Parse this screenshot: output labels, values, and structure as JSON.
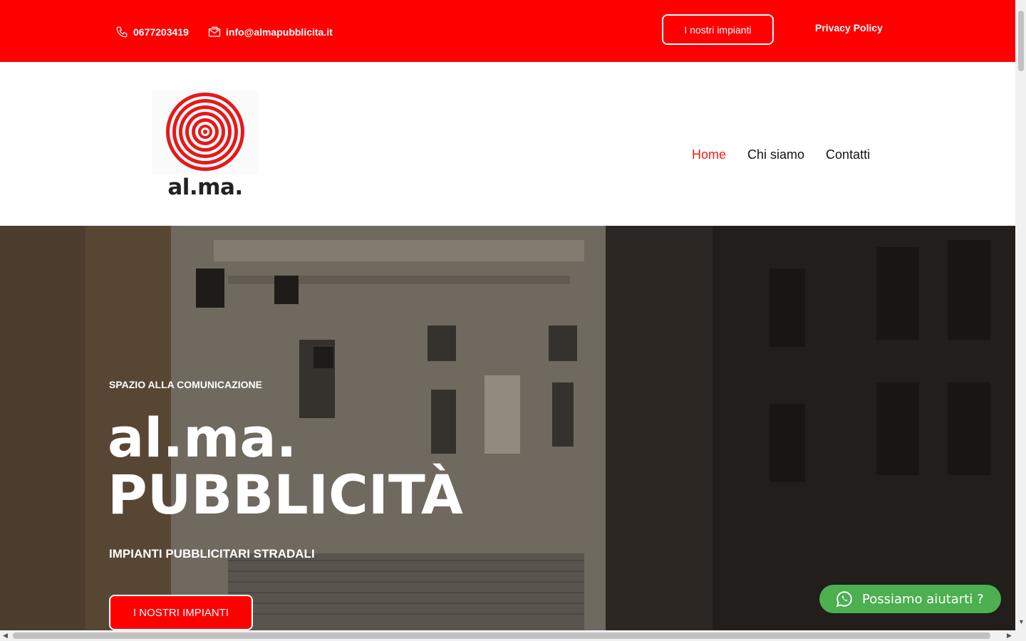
{
  "topbar": {
    "phone": "0677203419",
    "email": "info@almapubblicita.it",
    "plants_button": "I nostri impianti",
    "privacy": "Privacy Policy",
    "color": "#ff0000"
  },
  "header": {
    "logo_text": "al.ma.",
    "nav": {
      "home": "Home",
      "about": "Chi siamo",
      "contacts": "Contatti"
    }
  },
  "hero": {
    "kicker": "SPAZIO ALLA COMUNICAZIONE",
    "title_line1": "al.ma.",
    "title_line2": "PUBBLICITÀ",
    "subtitle": "IMPIANTI PUBBLICITARI STRADALI",
    "cta": "I NOSTRI IMPIANTI"
  },
  "whatsapp": {
    "label": "Possiamo aiutarti ?",
    "color": "#4caf50"
  }
}
